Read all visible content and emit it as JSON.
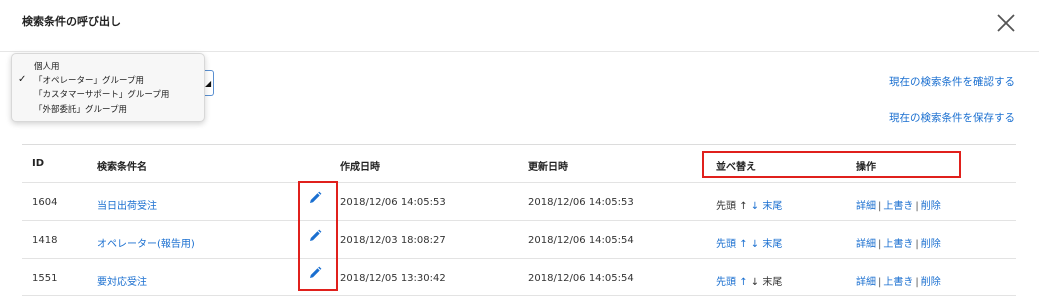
{
  "header": {
    "title": "検索条件の呼び出し",
    "close_icon": "close-icon"
  },
  "dropdown": {
    "options": [
      {
        "label": "個人用",
        "checked": false
      },
      {
        "label": "「オペレーター」グループ用",
        "checked": true
      },
      {
        "label": "「カスタマーサポート」グループ用",
        "checked": false
      },
      {
        "label": "「外部委託」グループ用",
        "checked": false
      }
    ],
    "check_mark": "✓"
  },
  "links": {
    "confirm": "現在の検索条件を確認する",
    "save": "現在の検索条件を保存する"
  },
  "table": {
    "headers": {
      "id": "ID",
      "name": "検索条件名",
      "created": "作成日時",
      "updated": "更新日時",
      "sort": "並べ替え",
      "ops": "操作"
    },
    "rows": [
      {
        "id": "1604",
        "name": "当日出荷受注",
        "created": "2018/12/06 14:05:53",
        "updated": "2018/12/06 14:05:53",
        "sort": {
          "first": "先頭",
          "up": "↑",
          "down": "↓",
          "last": "末尾"
        },
        "ops": {
          "detail": "詳細",
          "overwrite": "上書き",
          "delete": "削除",
          "sep": "|"
        }
      },
      {
        "id": "1418",
        "name": "オペレーター(報告用)",
        "created": "2018/12/03 18:08:27",
        "updated": "2018/12/06 14:05:54",
        "sort": {
          "first": "先頭",
          "up": "↑",
          "down": "↓",
          "last": "末尾"
        },
        "ops": {
          "detail": "詳細",
          "overwrite": "上書き",
          "delete": "削除",
          "sep": "|"
        }
      },
      {
        "id": "1551",
        "name": "要対応受注",
        "created": "2018/12/05 13:30:42",
        "updated": "2018/12/06 14:05:54",
        "sort": {
          "first": "先頭",
          "up": "↑",
          "down": "↓",
          "last": "末尾"
        },
        "ops": {
          "detail": "詳細",
          "overwrite": "上書き",
          "delete": "削除",
          "sep": "|"
        }
      }
    ]
  },
  "colors": {
    "link": "#1a6fd0",
    "highlight": "#e0201c"
  },
  "icons": {
    "edit": "pencil-icon"
  }
}
